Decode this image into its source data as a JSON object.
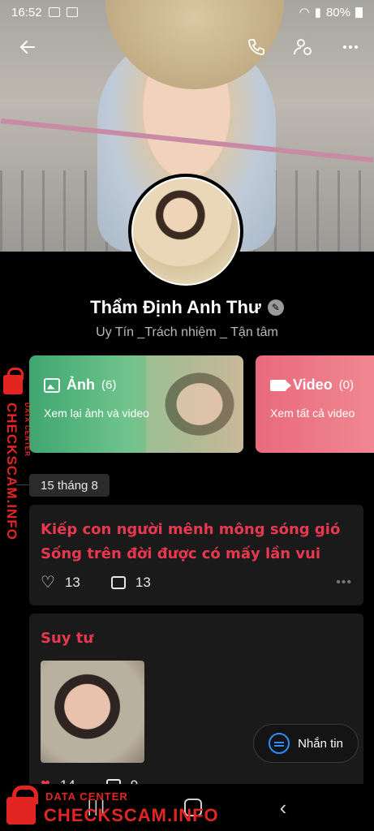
{
  "status_bar": {
    "time": "16:52",
    "battery": "80%"
  },
  "header": {
    "back_icon": "arrow-left-icon",
    "call_icon": "phone-icon",
    "profile_settings_icon": "user-settings-icon",
    "more_icon": "more-horizontal-icon"
  },
  "profile": {
    "name": "Thẩm Định Anh Thư",
    "bio": "Uy Tín _Trách nhiệm _ Tận tâm"
  },
  "media": {
    "photo": {
      "label": "Ảnh",
      "count": "(6)",
      "subtitle": "Xem lại ảnh và video"
    },
    "video": {
      "label": "Video",
      "count": "(0)",
      "subtitle": "Xem tất cả video"
    }
  },
  "timeline": {
    "date": "15 tháng 8",
    "posts": [
      {
        "line1": "Kiếp con người mênh mông sóng gió",
        "line2": "Sống trên đời được có mấy lần vui",
        "likes": "13",
        "comments": "13"
      },
      {
        "line1": "Suy tư",
        "likes": "14",
        "comments": "9"
      }
    ]
  },
  "fab": {
    "label": "Nhắn tin"
  },
  "watermark": {
    "small": "DATA CENTER",
    "big": "CHECKSCAM.INFO"
  },
  "colors": {
    "post_text": "#e8384f",
    "photo_card": "#3fa66f",
    "video_card": "#e96a7d",
    "watermark": "#e32522",
    "accent_blue": "#2d8cff"
  }
}
